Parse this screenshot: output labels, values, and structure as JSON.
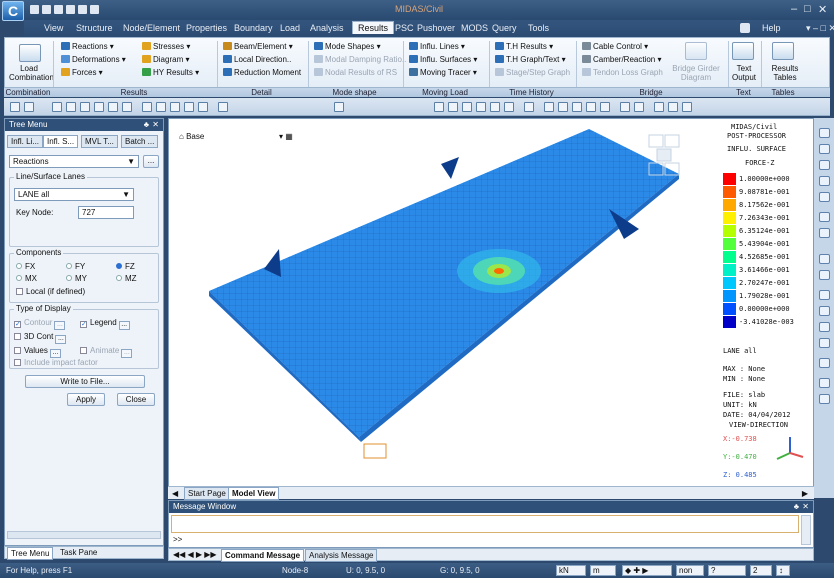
{
  "app": {
    "title": "MIDAS/Civil"
  },
  "menu": [
    "View",
    "Structure",
    "Node/Element",
    "Properties",
    "Boundary",
    "Load",
    "Analysis",
    "Results",
    "PSC",
    "Pushover",
    "MODS",
    "Query",
    "Tools"
  ],
  "menu_active": "Results",
  "help": "Help",
  "ribbon": {
    "load_combination": "Load Combination",
    "reactions": "Reactions",
    "deformations": "Deformations",
    "forces": "Forces",
    "stresses": "Stresses",
    "diagram": "Diagram",
    "hy_results": "HY Results",
    "beam_element": "Beam/Element",
    "local_direction": "Local Direction..",
    "reduction_moment": "Reduction Moment",
    "mode_shapes": "Mode Shapes",
    "modal_damping": "Modal Damping Ratio..",
    "nodal_results_rs": "Nodal Results of RS",
    "influ_lines": "Influ. Lines",
    "influ_surfaces": "Influ. Surfaces",
    "moving_tracer": "Moving Tracer",
    "th_results": "T.H Results",
    "th_graph": "T.H Graph/Text",
    "stage_graph": "Stage/Step Graph",
    "cable_control": "Cable Control",
    "camber_reaction": "Camber/Reaction",
    "tendon_loss": "Tendon Loss Graph",
    "bridge_girder": "Bridge Girder Diagram",
    "text_output": "Text Output",
    "results_tables": "Results Tables",
    "groups": [
      "Combination",
      "Results",
      "Detail",
      "Mode shape",
      "Moving Load",
      "Time History",
      "Bridge",
      "Text",
      "Tables"
    ]
  },
  "tree": {
    "title": "Tree Menu",
    "tabs": [
      "Infl. Li...",
      "Infl. S...",
      "MVL T...",
      "Batch ..."
    ],
    "result_type": "Reactions",
    "lanes_group": "Line/Surface Lanes",
    "lane_value": "LANE all",
    "key_node_label": "Key Node:",
    "key_node_value": "727",
    "components_group": "Components",
    "components": [
      "FX",
      "FY",
      "FZ",
      "MX",
      "MY",
      "MZ"
    ],
    "selected_component": "FZ",
    "local_label": "Local (if defined)",
    "display_group": "Type of Display",
    "contour": "Contour",
    "legend": "Legend",
    "cont3d": "3D Cont",
    "values": "Values",
    "animate": "Animate",
    "include_impact": "Include impact factor",
    "write_file": "Write to File...",
    "apply": "Apply",
    "close": "Close"
  },
  "left_tabs": [
    "Tree Menu",
    "Task Pane"
  ],
  "view": {
    "base_label": "Base",
    "tabs": [
      "Start Page",
      "Model View"
    ]
  },
  "legend": {
    "header1": "MIDAS/Civil",
    "header2": "POST-PROCESSOR",
    "header3": "INFLU. SURFACE",
    "component": "FORCE-Z",
    "levels": [
      "1.00000e+000",
      "9.08781e-001",
      "8.17562e-001",
      "7.26343e-001",
      "6.35124e-001",
      "5.43904e-001",
      "4.52685e-001",
      "3.61466e-001",
      "2.70247e-001",
      "1.79028e-001",
      "0.00000e+000",
      "-3.41028e-003"
    ],
    "colors": [
      "#ff0000",
      "#ff5a00",
      "#ffa800",
      "#fff000",
      "#b4ff00",
      "#52ff3a",
      "#00ff8c",
      "#00f0c8",
      "#00c8ff",
      "#0096ff",
      "#0050ff",
      "#0000c8"
    ],
    "lane": "LANE all",
    "max": "MAX : None",
    "min": "MIN : None",
    "file": "FILE: slab",
    "unit": "UNIT: kN",
    "date": "DATE: 04/04/2012",
    "view_dir": "VIEW-DIRECTION",
    "x": "X:-0.738",
    "y": "Y:-0.470",
    "z": "Z: 0.485"
  },
  "message": {
    "title": "Message Window",
    "prompt": ">>",
    "tabs": [
      "Command Message",
      "Analysis Message"
    ]
  },
  "status": {
    "help": "For Help, press F1",
    "node": "Node-8",
    "u": "U: 0, 9.5, 0",
    "g": "G: 0, 9.5, 0",
    "force_unit": "kN",
    "length_unit": "m",
    "none": "non",
    "page": "2"
  }
}
